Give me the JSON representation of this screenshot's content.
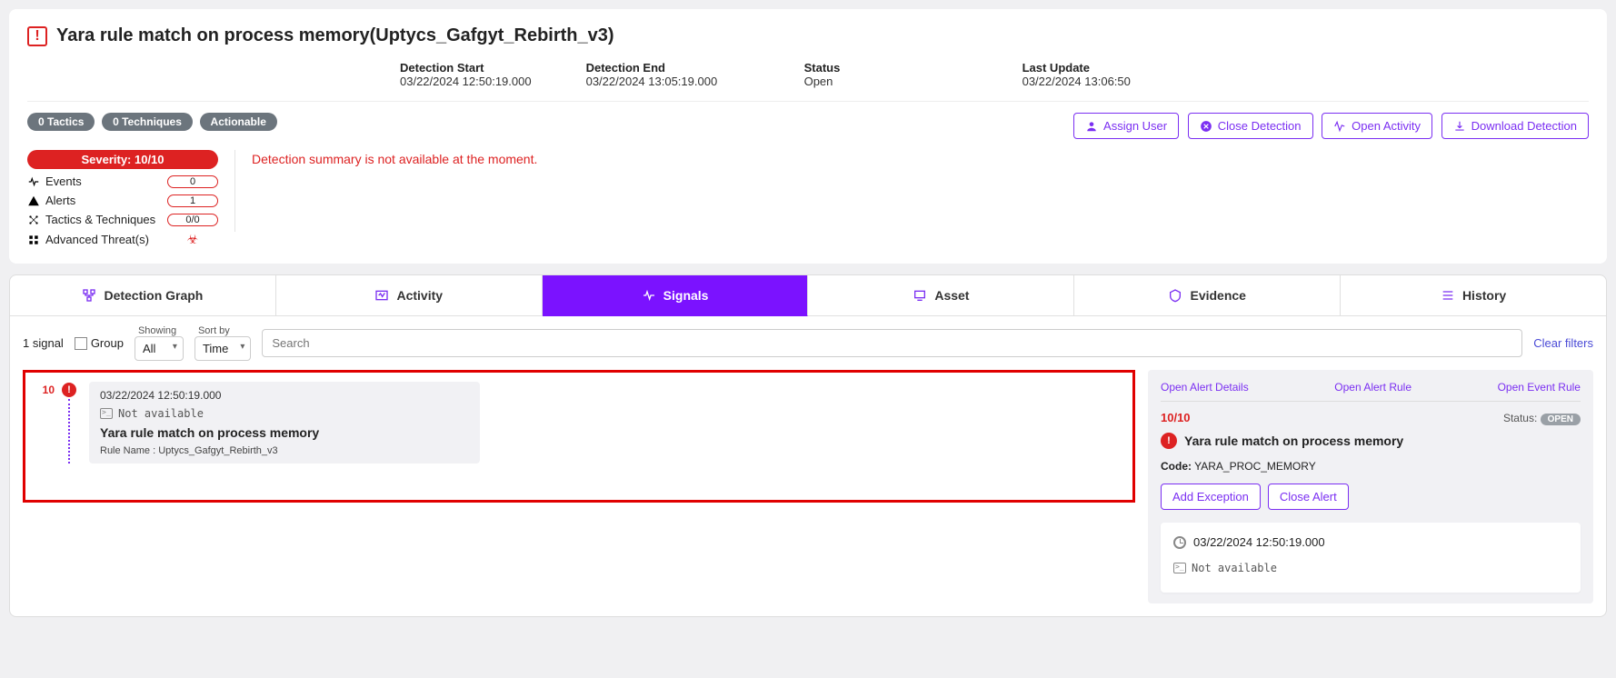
{
  "header": {
    "title": "Yara rule match on process memory(Uptycs_Gafgyt_Rebirth_v3)",
    "meta": {
      "detection_start_label": "Detection Start",
      "detection_start": "03/22/2024 12:50:19.000",
      "detection_end_label": "Detection End",
      "detection_end": "03/22/2024 13:05:19.000",
      "status_label": "Status",
      "status": "Open",
      "last_update_label": "Last Update",
      "last_update": "03/22/2024 13:06:50"
    },
    "pills": {
      "tactics": "0 Tactics",
      "techniques": "0 Techniques",
      "actionable": "Actionable"
    },
    "actions": {
      "assign_user": "Assign User",
      "close_detection": "Close Detection",
      "open_activity": "Open Activity",
      "download_detection": "Download Detection"
    },
    "severity": {
      "bar": "Severity: 10/10",
      "events_label": "Events",
      "events": "0",
      "alerts_label": "Alerts",
      "alerts": "1",
      "tt_label": "Tactics & Techniques",
      "tt": "0/0",
      "adv_label": "Advanced Threat(s)"
    },
    "summary_missing": "Detection summary is not available at the moment."
  },
  "tabs": {
    "detection_graph": "Detection Graph",
    "activity": "Activity",
    "signals": "Signals",
    "asset": "Asset",
    "evidence": "Evidence",
    "history": "History"
  },
  "filters": {
    "count": "1 signal",
    "group_label": "Group",
    "showing_label": "Showing",
    "showing_value": "All",
    "sort_label": "Sort by",
    "sort_value": "Time",
    "search_placeholder": "Search",
    "clear": "Clear filters"
  },
  "signal_entry": {
    "score": "10",
    "timestamp": "03/22/2024 12:50:19.000",
    "na": "Not available",
    "title": "Yara rule match on process memory",
    "rule_label": "Rule Name :",
    "rule_value": "Uptycs_Gafgyt_Rebirth_v3"
  },
  "right_panel": {
    "links": {
      "alert_details": "Open Alert Details",
      "alert_rule": "Open Alert Rule",
      "event_rule": "Open Event Rule"
    },
    "score": "10/10",
    "status_label": "Status:",
    "status_badge": "OPEN",
    "title": "Yara rule match on process memory",
    "code_label": "Code:",
    "code_value": "YARA_PROC_MEMORY",
    "buttons": {
      "add_exception": "Add Exception",
      "close_alert": "Close Alert"
    },
    "inner": {
      "timestamp": "03/22/2024 12:50:19.000",
      "na": "Not available"
    }
  }
}
